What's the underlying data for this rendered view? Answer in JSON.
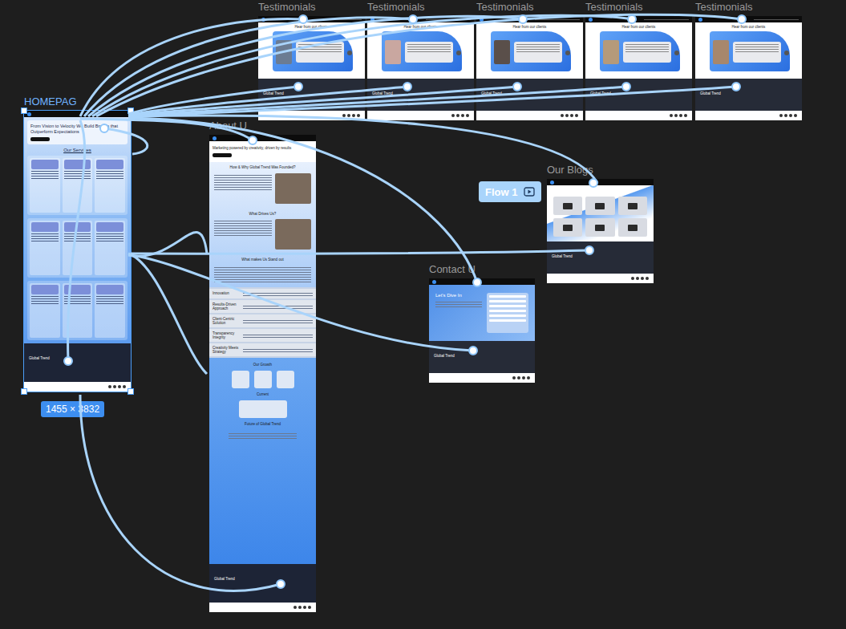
{
  "brand": "Global Trend",
  "flow": {
    "label": "Flow 1"
  },
  "selection": {
    "size": "1455 × 3832"
  },
  "homepage": {
    "label": "HOMEPAG",
    "selected": true,
    "hero": "From Vision to Velocity We Build Brands that Outperform Expectations",
    "services_title": "Our Services"
  },
  "testimonials": [
    {
      "label": "Testimonials",
      "heading": "Hear from our clients",
      "selected": false
    },
    {
      "label": "Testimonials",
      "heading": "Hear from our clients",
      "selected": false
    },
    {
      "label": "Testimonials",
      "heading": "Hear from our clients",
      "selected": false
    },
    {
      "label": "Testimonials",
      "heading": "Hear from our clients",
      "selected": false
    },
    {
      "label": "Testimonials",
      "heading": "Hear from our clients",
      "selected": false
    }
  ],
  "about": {
    "label": "About U",
    "selected": false,
    "tagline": "Marketing powered by creativity, driven by results",
    "sections": [
      "How & Why Global Trend Was Founded?",
      "What Drives Us?",
      "What makes Us Stand out"
    ],
    "values": [
      "Innovation",
      "Results-Driven Approach",
      "Client-Centric Solution",
      "Transparency Integrity",
      "Creativity Meets Strategy"
    ],
    "growth_title": "Our Growth",
    "current_title": "Current",
    "future_title": "Future of Global Trend"
  },
  "blogs": {
    "label": "Our Blogs",
    "selected": false
  },
  "contact": {
    "label": "Contact U",
    "selected": false,
    "heading": "Let's Dive In"
  }
}
